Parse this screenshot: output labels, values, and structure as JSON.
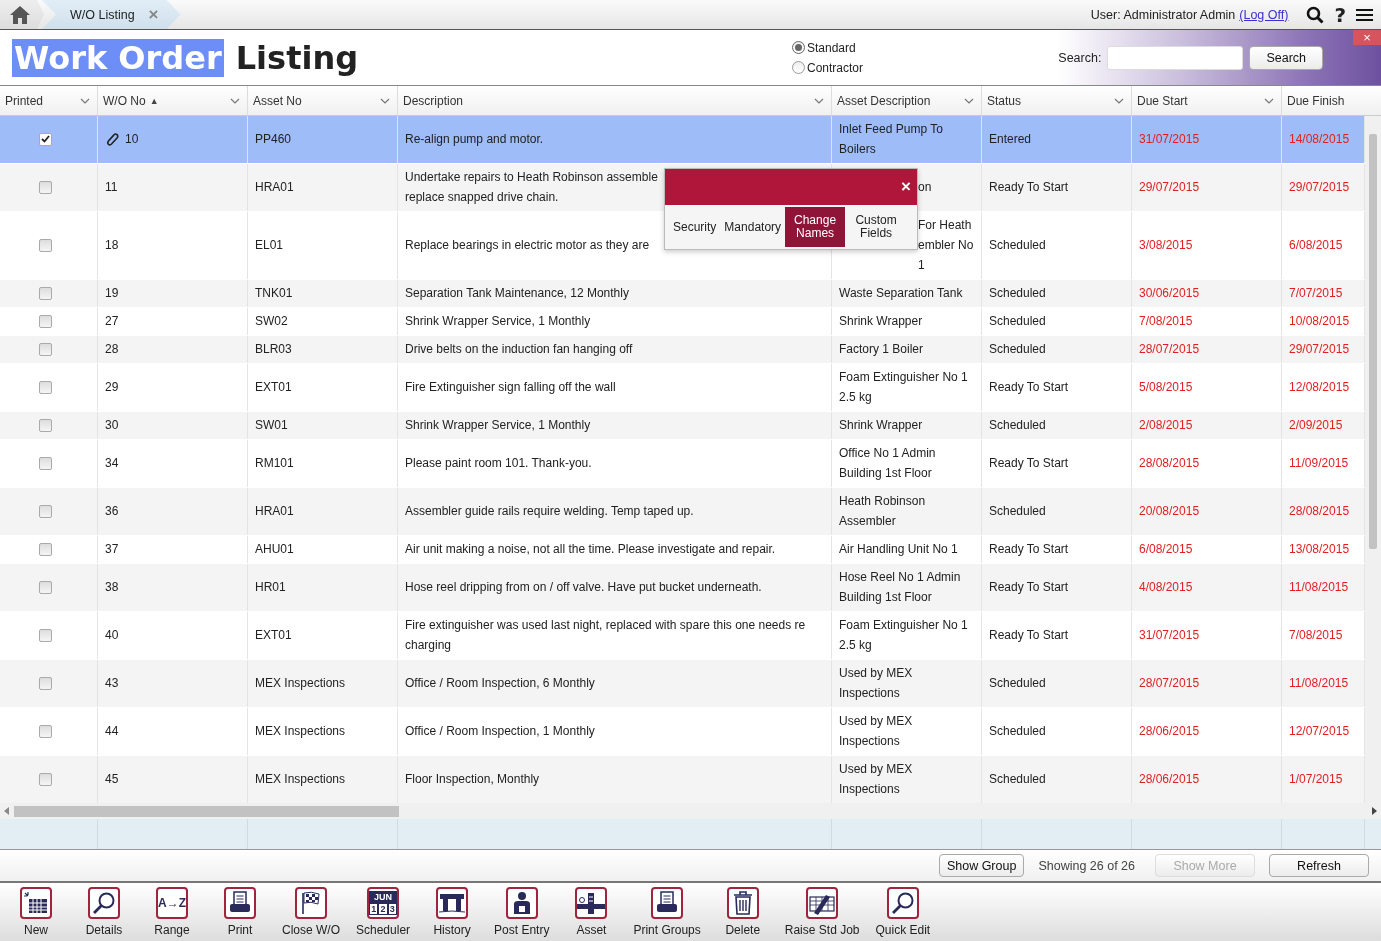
{
  "top_bar": {
    "tab": {
      "label": "W/O Listing",
      "close": "×"
    },
    "user_label": "User: Administrator Admin",
    "logoff_link": "(Log Off)",
    "help": "?"
  },
  "title": [
    {
      "text": "Work Order",
      "highlighted": true
    },
    {
      "text": "Listing",
      "highlighted": false
    }
  ],
  "view_options": [
    {
      "label": "Standard",
      "selected": true
    },
    {
      "label": "Contractor",
      "selected": false
    }
  ],
  "search": {
    "label": "Search:",
    "button": "Search"
  },
  "close_panel": "×",
  "columns": [
    {
      "label": "Printed"
    },
    {
      "label": "W/O No",
      "sort_mark": "▲"
    },
    {
      "label": "Asset No"
    },
    {
      "label": "Description"
    },
    {
      "label": "Asset Description"
    },
    {
      "label": "Status"
    },
    {
      "label": "Due Start"
    },
    {
      "label": "Due Finish"
    }
  ],
  "rows": [
    {
      "selected": true,
      "printed": true,
      "attachment": true,
      "wo": "10",
      "asset": "PP460",
      "description": "Re-align pump and motor.",
      "asset_description": "Inlet Feed Pump To Boilers",
      "covered": false,
      "status": "Entered",
      "due_start": "31/07/2015",
      "due_finish": "14/08/2015"
    },
    {
      "selected": false,
      "printed": false,
      "attachment": false,
      "wo": "11",
      "asset": "HRA01",
      "description": "Undertake repairs to Heath Robinson assemble\nreplace snapped drive chain.",
      "asset_description": "on",
      "covered": true,
      "status": "Ready To Start",
      "due_start": "29/07/2015",
      "due_finish": "29/07/2015"
    },
    {
      "selected": false,
      "printed": false,
      "attachment": false,
      "wo": "18",
      "asset": "EL01",
      "description": "Replace bearings in electric motor as they are",
      "asset_description": "For Heath embler No 1",
      "covered": true,
      "status": "Scheduled",
      "due_start": "3/08/2015",
      "due_finish": "6/08/2015"
    },
    {
      "selected": false,
      "printed": false,
      "attachment": false,
      "wo": "19",
      "asset": "TNK01",
      "description": "Separation Tank Maintenance, 12 Monthly",
      "asset_description": "Waste Separation Tank",
      "covered": false,
      "status": "Scheduled",
      "due_start": "30/06/2015",
      "due_finish": "7/07/2015"
    },
    {
      "selected": false,
      "printed": false,
      "attachment": false,
      "wo": "27",
      "asset": "SW02",
      "description": "Shrink Wrapper Service, 1 Monthly",
      "asset_description": "Shrink Wrapper",
      "covered": false,
      "status": "Scheduled",
      "due_start": "7/08/2015",
      "due_finish": "10/08/2015"
    },
    {
      "selected": false,
      "printed": false,
      "attachment": false,
      "wo": "28",
      "asset": "BLR03",
      "description": "Drive belts on the induction fan hanging off",
      "asset_description": "Factory 1 Boiler",
      "covered": false,
      "status": "Scheduled",
      "due_start": "28/07/2015",
      "due_finish": "29/07/2015"
    },
    {
      "selected": false,
      "printed": false,
      "attachment": false,
      "wo": "29",
      "asset": "EXT01",
      "description": "Fire Extinguisher sign falling off the wall",
      "asset_description": "Foam Extinguisher No 1 2.5 kg",
      "covered": false,
      "status": "Ready To Start",
      "due_start": "5/08/2015",
      "due_finish": "12/08/2015"
    },
    {
      "selected": false,
      "printed": false,
      "attachment": false,
      "wo": "30",
      "asset": "SW01",
      "description": "Shrink Wrapper Service, 1 Monthly",
      "asset_description": "Shrink Wrapper",
      "covered": false,
      "status": "Scheduled",
      "due_start": "2/08/2015",
      "due_finish": "2/09/2015"
    },
    {
      "selected": false,
      "printed": false,
      "attachment": false,
      "wo": "34",
      "asset": "RM101",
      "description": "Please paint room 101. Thank-you.",
      "asset_description": "Office No 1 Admin Building 1st Floor",
      "covered": false,
      "status": "Ready To Start",
      "due_start": "28/08/2015",
      "due_finish": "11/09/2015"
    },
    {
      "selected": false,
      "printed": false,
      "attachment": false,
      "wo": "36",
      "asset": "HRA01",
      "description": "Assembler guide rails require welding. Temp taped up.",
      "asset_description": "Heath Robinson Assembler",
      "covered": false,
      "status": "Scheduled",
      "due_start": "20/08/2015",
      "due_finish": "28/08/2015"
    },
    {
      "selected": false,
      "printed": false,
      "attachment": false,
      "wo": "37",
      "asset": "AHU01",
      "description": "Air unit making a noise, not all the time. Please investigate and repair.",
      "asset_description": "Air Handling Unit No 1",
      "covered": false,
      "status": "Ready To Start",
      "due_start": "6/08/2015",
      "due_finish": "13/08/2015"
    },
    {
      "selected": false,
      "printed": false,
      "attachment": false,
      "wo": "38",
      "asset": "HR01",
      "description": "Hose reel dripping from on / off valve. Have put bucket underneath.",
      "asset_description": "Hose Reel No 1 Admin Building 1st Floor",
      "covered": false,
      "status": "Ready To Start",
      "due_start": "4/08/2015",
      "due_finish": "11/08/2015"
    },
    {
      "selected": false,
      "printed": false,
      "attachment": false,
      "wo": "40",
      "asset": "EXT01",
      "description": "Fire extinguisher was used last night, replaced with spare this one needs re\ncharging",
      "asset_description": "Foam Extinguisher No 1 2.5 kg",
      "covered": false,
      "status": "Ready To Start",
      "due_start": "31/07/2015",
      "due_finish": "7/08/2015"
    },
    {
      "selected": false,
      "printed": false,
      "attachment": false,
      "wo": "43",
      "asset": "MEX Inspections",
      "description": "Office / Room Inspection, 6 Monthly",
      "asset_description": "Used by MEX Inspections",
      "covered": false,
      "status": "Scheduled",
      "due_start": "28/07/2015",
      "due_finish": "11/08/2015"
    },
    {
      "selected": false,
      "printed": false,
      "attachment": false,
      "wo": "44",
      "asset": "MEX Inspections",
      "description": "Office / Room Inspection, 1 Monthly",
      "asset_description": "Used by MEX Inspections",
      "covered": false,
      "status": "Scheduled",
      "due_start": "28/06/2015",
      "due_finish": "12/07/2015"
    },
    {
      "selected": false,
      "printed": false,
      "attachment": false,
      "wo": "45",
      "asset": "MEX Inspections",
      "description": "Floor Inspection, Monthly",
      "asset_description": "Used by MEX Inspections",
      "covered": false,
      "status": "Scheduled",
      "due_start": "28/06/2015",
      "due_finish": "1/07/2015"
    }
  ],
  "popup": {
    "close": "×",
    "tabs": [
      {
        "label": "Security",
        "selected": false
      },
      {
        "label": "Mandatory",
        "selected": false
      },
      {
        "label": "Change Names",
        "selected": true
      },
      {
        "label": "Custom Fields",
        "selected": false
      }
    ]
  },
  "footer": {
    "show_group": "Show Group",
    "count": "Showing 26 of 26",
    "show_more": {
      "label": "Show More",
      "disabled": true
    },
    "refresh": "Refresh"
  },
  "toolbar": [
    {
      "label": "New"
    },
    {
      "label": "Details"
    },
    {
      "label": "Range",
      "icon_text": "A→Z"
    },
    {
      "label": "Print"
    },
    {
      "label": "Close W/O"
    },
    {
      "label": "Scheduler",
      "icon_text": "JUN",
      "icon_digits": [
        "1",
        "2",
        "3"
      ]
    },
    {
      "label": "History"
    },
    {
      "label": "Post Entry"
    },
    {
      "label": "Asset"
    },
    {
      "label": "Print Groups"
    },
    {
      "label": "Delete"
    },
    {
      "label": "Raise Std Job"
    },
    {
      "label": "Quick Edit"
    }
  ]
}
